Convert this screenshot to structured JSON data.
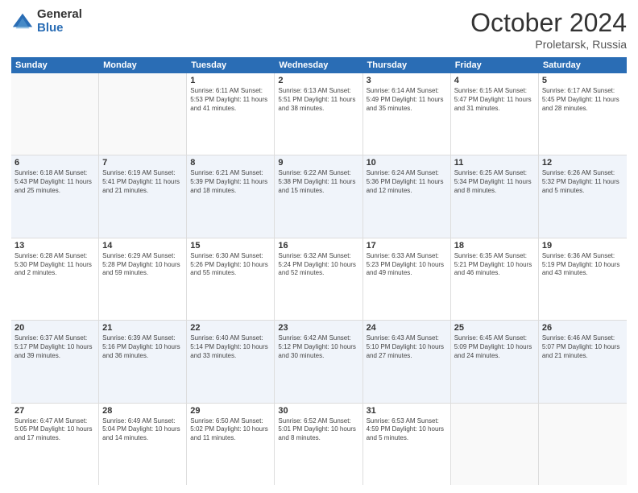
{
  "logo": {
    "general": "General",
    "blue": "Blue"
  },
  "title": "October 2024",
  "subtitle": "Proletarsk, Russia",
  "days": [
    "Sunday",
    "Monday",
    "Tuesday",
    "Wednesday",
    "Thursday",
    "Friday",
    "Saturday"
  ],
  "rows": [
    [
      {
        "num": "",
        "info": ""
      },
      {
        "num": "",
        "info": ""
      },
      {
        "num": "1",
        "info": "Sunrise: 6:11 AM\nSunset: 5:53 PM\nDaylight: 11 hours and 41 minutes."
      },
      {
        "num": "2",
        "info": "Sunrise: 6:13 AM\nSunset: 5:51 PM\nDaylight: 11 hours and 38 minutes."
      },
      {
        "num": "3",
        "info": "Sunrise: 6:14 AM\nSunset: 5:49 PM\nDaylight: 11 hours and 35 minutes."
      },
      {
        "num": "4",
        "info": "Sunrise: 6:15 AM\nSunset: 5:47 PM\nDaylight: 11 hours and 31 minutes."
      },
      {
        "num": "5",
        "info": "Sunrise: 6:17 AM\nSunset: 5:45 PM\nDaylight: 11 hours and 28 minutes."
      }
    ],
    [
      {
        "num": "6",
        "info": "Sunrise: 6:18 AM\nSunset: 5:43 PM\nDaylight: 11 hours and 25 minutes."
      },
      {
        "num": "7",
        "info": "Sunrise: 6:19 AM\nSunset: 5:41 PM\nDaylight: 11 hours and 21 minutes."
      },
      {
        "num": "8",
        "info": "Sunrise: 6:21 AM\nSunset: 5:39 PM\nDaylight: 11 hours and 18 minutes."
      },
      {
        "num": "9",
        "info": "Sunrise: 6:22 AM\nSunset: 5:38 PM\nDaylight: 11 hours and 15 minutes."
      },
      {
        "num": "10",
        "info": "Sunrise: 6:24 AM\nSunset: 5:36 PM\nDaylight: 11 hours and 12 minutes."
      },
      {
        "num": "11",
        "info": "Sunrise: 6:25 AM\nSunset: 5:34 PM\nDaylight: 11 hours and 8 minutes."
      },
      {
        "num": "12",
        "info": "Sunrise: 6:26 AM\nSunset: 5:32 PM\nDaylight: 11 hours and 5 minutes."
      }
    ],
    [
      {
        "num": "13",
        "info": "Sunrise: 6:28 AM\nSunset: 5:30 PM\nDaylight: 11 hours and 2 minutes."
      },
      {
        "num": "14",
        "info": "Sunrise: 6:29 AM\nSunset: 5:28 PM\nDaylight: 10 hours and 59 minutes."
      },
      {
        "num": "15",
        "info": "Sunrise: 6:30 AM\nSunset: 5:26 PM\nDaylight: 10 hours and 55 minutes."
      },
      {
        "num": "16",
        "info": "Sunrise: 6:32 AM\nSunset: 5:24 PM\nDaylight: 10 hours and 52 minutes."
      },
      {
        "num": "17",
        "info": "Sunrise: 6:33 AM\nSunset: 5:23 PM\nDaylight: 10 hours and 49 minutes."
      },
      {
        "num": "18",
        "info": "Sunrise: 6:35 AM\nSunset: 5:21 PM\nDaylight: 10 hours and 46 minutes."
      },
      {
        "num": "19",
        "info": "Sunrise: 6:36 AM\nSunset: 5:19 PM\nDaylight: 10 hours and 43 minutes."
      }
    ],
    [
      {
        "num": "20",
        "info": "Sunrise: 6:37 AM\nSunset: 5:17 PM\nDaylight: 10 hours and 39 minutes."
      },
      {
        "num": "21",
        "info": "Sunrise: 6:39 AM\nSunset: 5:16 PM\nDaylight: 10 hours and 36 minutes."
      },
      {
        "num": "22",
        "info": "Sunrise: 6:40 AM\nSunset: 5:14 PM\nDaylight: 10 hours and 33 minutes."
      },
      {
        "num": "23",
        "info": "Sunrise: 6:42 AM\nSunset: 5:12 PM\nDaylight: 10 hours and 30 minutes."
      },
      {
        "num": "24",
        "info": "Sunrise: 6:43 AM\nSunset: 5:10 PM\nDaylight: 10 hours and 27 minutes."
      },
      {
        "num": "25",
        "info": "Sunrise: 6:45 AM\nSunset: 5:09 PM\nDaylight: 10 hours and 24 minutes."
      },
      {
        "num": "26",
        "info": "Sunrise: 6:46 AM\nSunset: 5:07 PM\nDaylight: 10 hours and 21 minutes."
      }
    ],
    [
      {
        "num": "27",
        "info": "Sunrise: 6:47 AM\nSunset: 5:05 PM\nDaylight: 10 hours and 17 minutes."
      },
      {
        "num": "28",
        "info": "Sunrise: 6:49 AM\nSunset: 5:04 PM\nDaylight: 10 hours and 14 minutes."
      },
      {
        "num": "29",
        "info": "Sunrise: 6:50 AM\nSunset: 5:02 PM\nDaylight: 10 hours and 11 minutes."
      },
      {
        "num": "30",
        "info": "Sunrise: 6:52 AM\nSunset: 5:01 PM\nDaylight: 10 hours and 8 minutes."
      },
      {
        "num": "31",
        "info": "Sunrise: 6:53 AM\nSunset: 4:59 PM\nDaylight: 10 hours and 5 minutes."
      },
      {
        "num": "",
        "info": ""
      },
      {
        "num": "",
        "info": ""
      }
    ]
  ]
}
